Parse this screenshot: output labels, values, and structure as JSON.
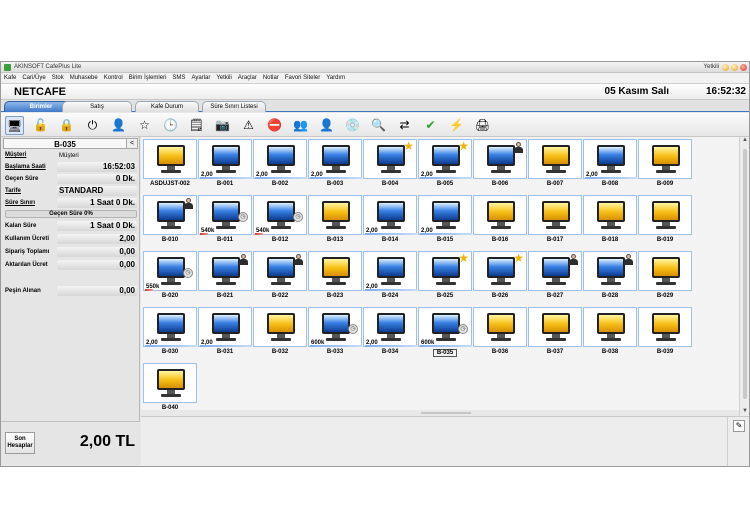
{
  "window": {
    "title": "AKINSOFT CafePlus Lite",
    "user": "Yetkili"
  },
  "menu": [
    "Kafe",
    "Cari/Üye",
    "Stok",
    "Muhasebe",
    "Kontrol",
    "Birim İşlemleri",
    "SMS",
    "Ayarlar",
    "Yetkili",
    "Araçlar",
    "Notlar",
    "Favori Siteler",
    "Yardım"
  ],
  "header": {
    "cafe_name": "NETCAFE",
    "date": "05 Kasım Salı",
    "time": "16:52:32"
  },
  "tabs": [
    "Birimler",
    "Satış",
    "Kafe Durum",
    "Süre Sınırı Listesi"
  ],
  "active_tab": "Birimler",
  "toolbar_icons": [
    "monitor-icon",
    "unlock-icon",
    "lock-icon",
    "power-icon",
    "user-icon",
    "star-icon",
    "clock-icon",
    "note-icon",
    "camera-icon",
    "warning-icon",
    "stop-icon",
    "users-icon",
    "disc-icon",
    "magnifier-icon",
    "transfer-icon",
    "check-icon",
    "alert-sign-icon",
    "printer-icon"
  ],
  "left_panel": {
    "unit": "B-035",
    "unit_button": "<",
    "fields": {
      "customer_label": "Müşteri",
      "customer_value": "Müşteri",
      "start_label": "Başlama Saati",
      "start_value": "16:52:03",
      "elapsed_label": "Geçen Süre",
      "elapsed_value": "0 Dk.",
      "tariff_label": "Tarife",
      "tariff_value": "STANDARD",
      "limit_label": "Süre Sınırı",
      "limit_value": "1 Saat 0 Dk.",
      "progress_label": "Geçen Süre 0%",
      "progress": 0,
      "remaining_label": "Kalan Süre",
      "remaining_value": "1 Saat 0 Dk.",
      "usage_fee_label": "Kullanım Ücreti",
      "usage_fee_value": "2,00",
      "order_total_label": "Sipariş Toplamı",
      "order_total_value": "0,00",
      "transfer_fee_label": "Aktarılan Ücret",
      "transfer_fee_value": "0,00",
      "prepaid_label": "Peşin Alınan",
      "prepaid_value": "0,00"
    },
    "last_accounts_button": "Son Hesaplar",
    "total": "2,00 TL"
  },
  "units": [
    {
      "name": "ASDUJST-002",
      "color": "yellow"
    },
    {
      "name": "B-001",
      "color": "blue",
      "price": "2,00"
    },
    {
      "name": "B-002",
      "color": "blue",
      "price": "2,00"
    },
    {
      "name": "B-003",
      "color": "blue",
      "price": "2,00"
    },
    {
      "name": "B-004",
      "color": "blue",
      "star": true
    },
    {
      "name": "B-005",
      "color": "blue",
      "price": "2,00",
      "star": true
    },
    {
      "name": "B-006",
      "color": "blue",
      "person": true
    },
    {
      "name": "B-007",
      "color": "yellow"
    },
    {
      "name": "B-008",
      "color": "blue",
      "price": "2,00"
    },
    {
      "name": "B-009",
      "color": "yellow"
    },
    {
      "name": "B-010",
      "color": "blue",
      "person": true
    },
    {
      "name": "B-011",
      "color": "blue",
      "price": "540k",
      "clock": true,
      "red": true
    },
    {
      "name": "B-012",
      "color": "blue",
      "price": "540k",
      "clock": true,
      "red": true
    },
    {
      "name": "B-013",
      "color": "yellow"
    },
    {
      "name": "B-014",
      "color": "blue",
      "price": "2,00"
    },
    {
      "name": "B-015",
      "color": "blue",
      "price": "2,00"
    },
    {
      "name": "B-016",
      "color": "yellow"
    },
    {
      "name": "B-017",
      "color": "yellow"
    },
    {
      "name": "B-018",
      "color": "yellow"
    },
    {
      "name": "B-019",
      "color": "yellow"
    },
    {
      "name": "B-020",
      "color": "blue",
      "price": "550k",
      "clock": true,
      "red": true
    },
    {
      "name": "B-021",
      "color": "blue",
      "person": true
    },
    {
      "name": "B-022",
      "color": "blue",
      "person": true
    },
    {
      "name": "B-023",
      "color": "yellow"
    },
    {
      "name": "B-024",
      "color": "blue",
      "price": "2,00"
    },
    {
      "name": "B-025",
      "color": "blue",
      "star": true
    },
    {
      "name": "B-026",
      "color": "blue",
      "star": true
    },
    {
      "name": "B-027",
      "color": "blue",
      "person": true
    },
    {
      "name": "B-028",
      "color": "blue",
      "person": true
    },
    {
      "name": "B-029",
      "color": "yellow"
    },
    {
      "name": "B-030",
      "color": "blue",
      "price": "2,00"
    },
    {
      "name": "B-031",
      "color": "blue",
      "price": "2,00"
    },
    {
      "name": "B-032",
      "color": "yellow"
    },
    {
      "name": "B-033",
      "color": "blue",
      "price": "600k",
      "clock": true
    },
    {
      "name": "B-034",
      "color": "blue",
      "price": "2,00"
    },
    {
      "name": "B-035",
      "color": "blue",
      "price": "600k",
      "clock": true,
      "selected": true
    },
    {
      "name": "B-036",
      "color": "yellow"
    },
    {
      "name": "B-037",
      "color": "yellow"
    },
    {
      "name": "B-038",
      "color": "yellow"
    },
    {
      "name": "B-039",
      "color": "yellow"
    },
    {
      "name": "B-040",
      "color": "yellow"
    }
  ]
}
